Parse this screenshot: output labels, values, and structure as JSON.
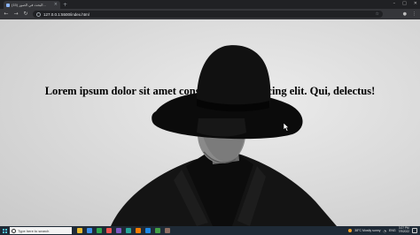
{
  "browser": {
    "tab_title": "(15) البحث في الصور...",
    "new_tab_symbol": "+",
    "close_tab_symbol": "×",
    "url": "127.0.0.1:5500/index.html",
    "window_controls": [
      "–",
      "□",
      "✕"
    ]
  },
  "page": {
    "heading": "Lorem ipsum dolor sit amet consectetur adipisicing elit. Qui, delectus!"
  },
  "taskbar": {
    "search_placeholder": "Type here to search",
    "weather": "38°C  Mostly sunny",
    "language": "ENG",
    "time": "3:27 PM",
    "date": "7/9/2022",
    "app_colors": [
      "#e8b931",
      "#3c8ee8",
      "#2da44e",
      "#ef5350",
      "#7e57c2",
      "#26a69a",
      "#f57c00",
      "#1e88e5",
      "#43a047",
      "#8d6e63"
    ]
  },
  "colors": {
    "chrome_dark": "#202124",
    "chrome_toolbar": "#35363a",
    "taskbar": "#1f2a36"
  }
}
